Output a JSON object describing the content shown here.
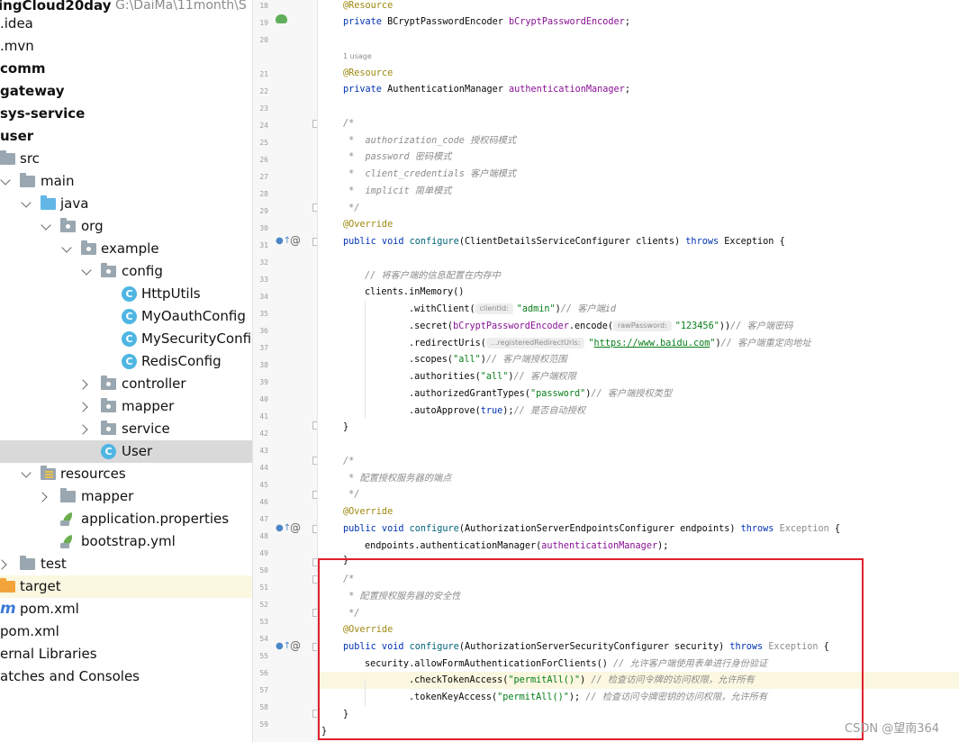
{
  "tree": {
    "root": {
      "name": "ingCloud20day",
      "path": "G:\\DaiMa\\11month\\S"
    },
    "items": [
      {
        "label": ".idea"
      },
      {
        "label": ".mvn"
      },
      {
        "label": "comm"
      },
      {
        "label": "gateway"
      },
      {
        "label": "sys-service"
      },
      {
        "label": "user"
      },
      {
        "label": "src"
      },
      {
        "label": "main"
      },
      {
        "label": "java"
      },
      {
        "label": "org"
      },
      {
        "label": "example"
      },
      {
        "label": "config"
      },
      {
        "label": "HttpUtils"
      },
      {
        "label": "MyOauthConfig"
      },
      {
        "label": "MySecurityConfig"
      },
      {
        "label": "RedisConfig"
      },
      {
        "label": "controller"
      },
      {
        "label": "mapper"
      },
      {
        "label": "service"
      },
      {
        "label": "User"
      },
      {
        "label": "resources"
      },
      {
        "label": "mapper"
      },
      {
        "label": "application.properties"
      },
      {
        "label": "bootstrap.yml"
      },
      {
        "label": "test"
      },
      {
        "label": "target"
      },
      {
        "label": "pom.xml"
      },
      {
        "label": "pom.xml"
      },
      {
        "label": "ernal Libraries"
      },
      {
        "label": "atches and Consoles"
      }
    ]
  },
  "editor": {
    "line_numbers": [
      "18",
      "19",
      "20",
      "21",
      "22",
      "23",
      "24",
      "25",
      "26",
      "27",
      "28",
      "29",
      "30",
      "31",
      "32",
      "33",
      "34",
      "35",
      "36",
      "37",
      "38",
      "39",
      "40",
      "41",
      "42",
      "43",
      "44",
      "45",
      "46",
      "47",
      "48",
      "49",
      "50",
      "51",
      "52",
      "53",
      "54",
      "55",
      "56",
      "57",
      "58",
      "59",
      "60"
    ],
    "usage_hint": "1 usage",
    "lines": {
      "l18": "@Resource",
      "l19a": "private ",
      "l19b": "BCryptPasswordEncoder ",
      "l19c": "bCryptPasswordEncoder",
      "l19d": ";",
      "l21": "@Resource",
      "l22a": "private ",
      "l22b": "AuthenticationManager ",
      "l22c": "authenticationManager",
      "l22d": ";",
      "l24": "/*",
      "l25": " *  authorization_code 授权码模式",
      "l26": " *  password 密码模式",
      "l27": " *  client_credentials 客户端模式",
      "l28": " *  implicit 简单模式",
      "l29": " */",
      "l30": "@Override",
      "l31a": "public void ",
      "l31b": "configure",
      "l31c": "(ClientDetailsServiceConfigurer clients) ",
      "l31d": "throws ",
      "l31e": "Exception {",
      "l33": "// 将客户端的信息配置在内存中",
      "l34": "clients.inMemory()",
      "l35a": ".withClient(",
      "l35hint": "clientId:",
      "l35b": "\"admin\"",
      "l35c": ")",
      "l35d": "// 客户端id",
      "l36a": ".secret(",
      "l36b": "bCryptPasswordEncoder",
      "l36c": ".encode(",
      "l36hint": "rawPassword:",
      "l36d": "\"123456\"",
      "l36e": "))",
      "l36f": "// 客户端密码",
      "l37a": ".redirectUris(",
      "l37hint": "...registeredRedirectUris:",
      "l37b": "\"",
      "l37c": "https://www.baidu.com",
      "l37d": "\"",
      "l37e": ")",
      "l37f": "// 客户端重定向地址",
      "l38a": ".scopes(",
      "l38b": "\"all\"",
      "l38c": ")",
      "l38d": "// 客户端授权范围",
      "l39a": ".authorities(",
      "l39b": "\"all\"",
      "l39c": ")",
      "l39d": "// 客户端权限",
      "l40a": ".authorizedGrantTypes(",
      "l40b": "\"password\"",
      "l40c": ")",
      "l40d": "// 客户端授权类型",
      "l41a": ".autoApprove(",
      "l41b": "true",
      "l41c": ");",
      "l41d": "// 是否自动授权",
      "l42": "}",
      "l44": "/*",
      "l45": " * 配置授权服务器的端点",
      "l46": " */",
      "l47": "@Override",
      "l48a": "public void ",
      "l48b": "configure",
      "l48c": "(AuthorizationServerEndpointsConfigurer endpoints) ",
      "l48d": "throws ",
      "l48e": "Exception",
      "l48f": " {",
      "l49a": "endpoints.authenticationManager(",
      "l49b": "authenticationManager",
      "l49c": ");",
      "l50": "}",
      "l51": "/*",
      "l52": " * 配置授权服务器的安全性",
      "l53": " */",
      "l54": "@Override",
      "l55a": "public void ",
      "l55b": "configure",
      "l55c": "(AuthorizationServerSecurityConfigurer security) ",
      "l55d": "throws ",
      "l55e": "Exception",
      "l55f": " {",
      "l56a": "security.allowFormAuthenticationForClients()",
      "l56b": " // 允许客户端使用表单进行身份验证",
      "l57a": ".checkTokenAccess(",
      "l57b": "\"permitAll()\"",
      "l57c": ")",
      "l57d": " // 检查访问令牌的访问权限，允许所有",
      "l58a": ".tokenKeyAccess(",
      "l58b": "\"permitAll()\"",
      "l58c": ");",
      "l58d": " // 检查访问令牌密钥的访问权限，允许所有",
      "l59": "}",
      "l60": "}"
    }
  },
  "watermark": "CSDN @望南364",
  "colors": {
    "highlight_box": "#e0202a",
    "keyword": "#0033b3",
    "annotation": "#9e880d",
    "field": "#871094",
    "string": "#067d17",
    "comment": "#8c8c8c"
  }
}
